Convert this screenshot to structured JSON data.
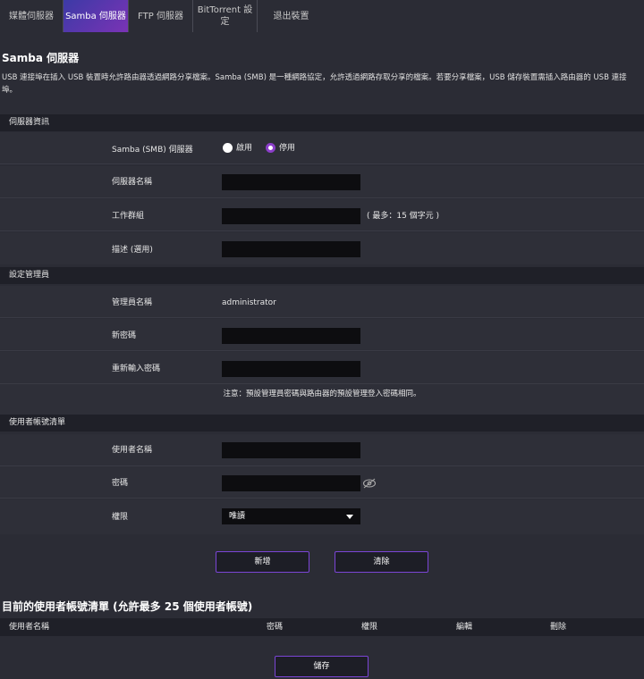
{
  "tabs": [
    "媒體伺服器",
    "Samba 伺服器",
    "FTP 伺服器",
    "BitTorrent 設定",
    "退出裝置"
  ],
  "page_title": "Samba 伺服器",
  "description": "USB 連接埠在插入 USB 裝置時允許路由器透過網路分享檔案。Samba (SMB) 是一種網路協定，允許透過網路存取分享的檔案。若要分享檔案，USB 儲存裝置需插入路由器的 USB 連接埠。",
  "server_info": {
    "title": "伺服器資訊",
    "samba_label": "Samba (SMB) 伺服器",
    "enable_label": "啟用",
    "disable_label": "停用",
    "selected": "停用",
    "server_name_label": "伺服器名稱",
    "server_name_value": "",
    "workgroup_label": "工作群組",
    "workgroup_value": "",
    "workgroup_hint": "( 最多：15 個字元 )",
    "description_label": "描述 (選用)",
    "description_value": ""
  },
  "admin": {
    "title": "設定管理員",
    "name_label": "管理員名稱",
    "name_value": "administrator",
    "new_password_label": "新密碼",
    "confirm_password_label": "重新輸入密碼",
    "note": "注意：預設管理員密碼與路由器的預設管理登入密碼相同。"
  },
  "user_accounts": {
    "title": "使用者帳號清單",
    "username_label": "使用者名稱",
    "password_label": "密碼",
    "permission_label": "權限",
    "permission_value": "唯讀",
    "add_button": "新增",
    "clear_button": "清除"
  },
  "current_list": {
    "title_prefix": "目前的使用者帳號清單 (允許最多 ",
    "max_count": "25",
    "title_suffix": " 個使用者帳號)",
    "columns": [
      "使用者名稱",
      "密碼",
      "權限",
      "編輯",
      "刪除"
    ]
  },
  "save_button": "儲存",
  "colors": {
    "accent": "#8b3ec9",
    "tab_active_start": "#3c3aa6",
    "tab_active_end": "#7a33b5"
  },
  "icons": {
    "password_toggle": "eye-slash-icon",
    "dropdown": "caret-down-icon"
  }
}
